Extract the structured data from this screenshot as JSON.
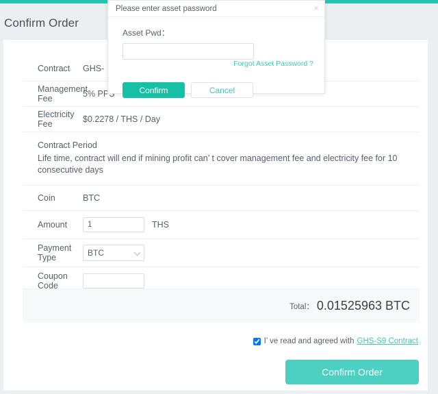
{
  "theme": {
    "accent_teal": "#25c6b0",
    "button_teal": "#4dd0c1",
    "modal_button_teal": "#15c0a6",
    "link_teal": "#3fc8b4",
    "page_bg": "#eceff1",
    "card_bg": "#ffffff",
    "total_strip_bg": "#f7f8fa"
  },
  "header": {
    "title": "Confirm Order"
  },
  "order": {
    "rows": [
      {
        "label": "Contract",
        "value": "GHS-"
      },
      {
        "label": "Management Fee",
        "value": "5% PPS"
      },
      {
        "label": "Electricity Fee",
        "value": "$0.2278 / THS / Day"
      }
    ],
    "period": {
      "title": "Contract Period",
      "body": "Life time, contract will end if mining profit can’  t cover management fee and electricity fee for 10 consecutive days"
    },
    "coin": {
      "label": "Coin",
      "value": "BTC"
    },
    "amount": {
      "label": "Amount",
      "value": "1",
      "placeholder": "",
      "unit": "THS"
    },
    "payment_type": {
      "label": "Payment Type",
      "selected": "BTC",
      "options": [
        "BTC"
      ]
    },
    "coupon": {
      "label": "Coupon Code",
      "value": "",
      "placeholder": ""
    },
    "total": {
      "label": "Total：",
      "value": "0.01525963 BTC"
    },
    "agreement": {
      "checked": true,
      "text": "I’  ve read and agreed with",
      "link": "GHS-S9 Contract"
    },
    "submit_label": "Confirm Order"
  },
  "modal": {
    "title": "Please enter asset password",
    "close_icon": "close-icon",
    "field_label": "Asset Pwd：",
    "field_value": "",
    "field_placeholder": "",
    "forgot_link": "Forgot Asset Password ?",
    "confirm_label": "Confirm",
    "cancel_label": "Cancel"
  }
}
